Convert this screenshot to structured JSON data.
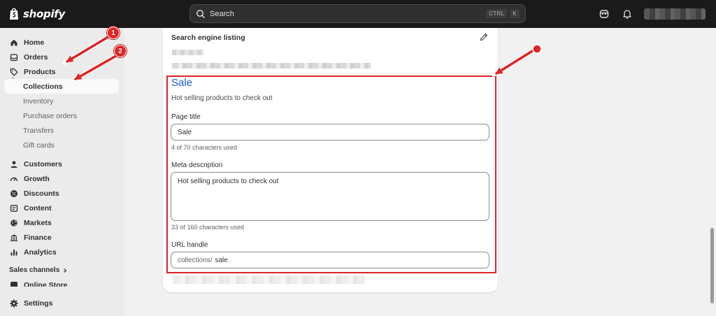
{
  "topbar": {
    "logo_text": "shopify",
    "search_placeholder": "Search",
    "shortcut_ctrl": "CTRL",
    "shortcut_key": "K"
  },
  "sidebar": {
    "items": [
      {
        "label": "Home",
        "icon": "home-icon"
      },
      {
        "label": "Orders",
        "icon": "inbox-icon"
      },
      {
        "label": "Products",
        "icon": "tag-icon"
      },
      {
        "label": "Collections"
      },
      {
        "label": "Inventory"
      },
      {
        "label": "Purchase orders"
      },
      {
        "label": "Transfers"
      },
      {
        "label": "Gift cards"
      },
      {
        "label": "Customers",
        "icon": "person-icon"
      },
      {
        "label": "Growth",
        "icon": "gauge-icon"
      },
      {
        "label": "Discounts",
        "icon": "discount-icon"
      },
      {
        "label": "Content",
        "icon": "content-icon"
      },
      {
        "label": "Markets",
        "icon": "globe-icon"
      },
      {
        "label": "Finance",
        "icon": "bank-icon"
      },
      {
        "label": "Analytics",
        "icon": "bar-chart-icon"
      }
    ],
    "sales_channels_label": "Sales channels",
    "online_store_label": "Online Store",
    "settings_label": "Settings"
  },
  "seo": {
    "card_title": "Search engine listing",
    "preview_title": "Sale",
    "preview_description": "Hot selling products to check out",
    "page_title_label": "Page title",
    "page_title_value": "Sale",
    "page_title_help": "4 of 70 characters used",
    "meta_description_label": "Meta description",
    "meta_description_value": "Hot selling products to check out",
    "meta_description_help": "33 of 160 characters used",
    "url_handle_label": "URL handle",
    "url_prefix": "collections/",
    "url_value": "sale"
  },
  "annotations": {
    "badge_1": "1",
    "badge_2": "2",
    "color": "#e02424"
  },
  "colors": {
    "topbar": "#1a1a1a",
    "sidebar": "#ebebeb",
    "link": "#1a5fd0"
  }
}
